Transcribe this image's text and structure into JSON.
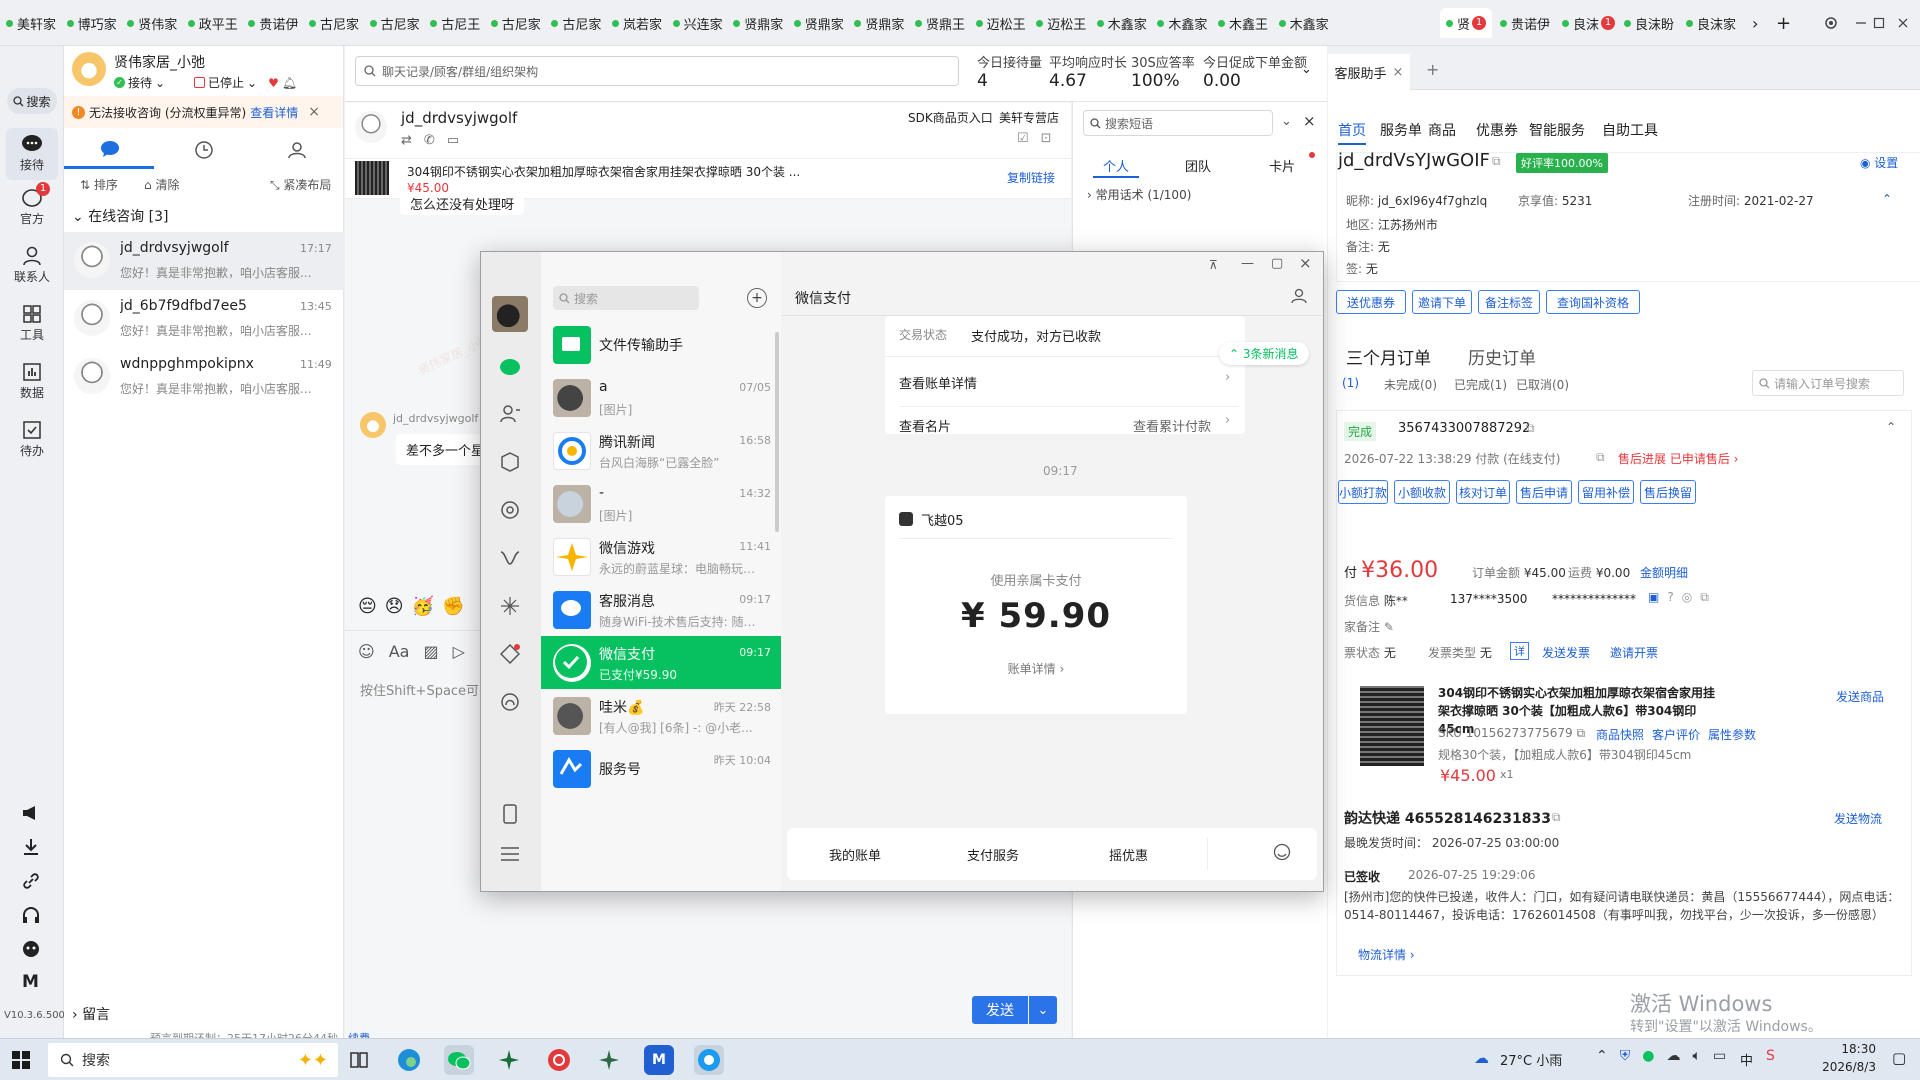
{
  "browser_tabs": [
    "美轩家",
    "博巧家",
    "贤伟家",
    "政平王",
    "贵诺伊",
    "古尼家",
    "古尼家",
    "古尼王",
    "古尼家",
    "古尼家",
    "岚若家",
    "兴连家",
    "贤鼎家",
    "贤鼎家",
    "贤鼎家",
    "贤鼎王",
    "迈松王",
    "迈松王",
    "木鑫家",
    "木鑫家",
    "木鑫王",
    "木鑫家"
  ],
  "tab_active": {
    "label": "贤",
    "badge": "1"
  },
  "tabs_right": [
    {
      "label": "贵诺伊",
      "badge": ""
    },
    {
      "label": "良沫",
      "badge": "1"
    },
    {
      "label": "良沫盼",
      "badge": ""
    },
    {
      "label": "良沫家",
      "badge": ""
    }
  ],
  "tab_more": "›",
  "tab_add": "+",
  "rail": {
    "search": "搜索",
    "items": [
      {
        "label": "接待",
        "icon": "chat-bubble-icon"
      },
      {
        "label": "官方",
        "icon": "notification-icon",
        "badge": "1"
      },
      {
        "label": "联系人",
        "icon": "person-icon"
      },
      {
        "label": "工具",
        "icon": "grid-icon"
      },
      {
        "label": "数据",
        "icon": "chart-icon"
      },
      {
        "label": "待办",
        "icon": "checkbox-icon"
      }
    ],
    "version": "V10.3.6.500"
  },
  "agent": {
    "name": "贤伟家居_小弛",
    "status_receive": "接待",
    "status_stop": "已停止"
  },
  "warning": {
    "text": "无法接收咨询 (分流权重异常)",
    "link": "查看详情"
  },
  "list_tools": {
    "sort": "排序",
    "clear": "清除",
    "layout": "紧凑布局"
  },
  "online": {
    "label": "在线咨询 [3]"
  },
  "conversations": [
    {
      "name": "jd_drdvsyjwgolf",
      "time": "17:17",
      "preview": "您好！真是非常抱歉，咱小店客服..."
    },
    {
      "name": "jd_6b7f9dfbd7ee5",
      "time": "13:45",
      "preview": "您好！真是非常抱歉，咱小店客服..."
    },
    {
      "name": "wdnppghmpokipnx",
      "time": "11:49",
      "preview": "您好！真是非常抱歉，咱小店客服..."
    }
  ],
  "leave_msg": "留言",
  "search_placeholder": "聊天记录/顾客/群组/组织架构",
  "stats": [
    {
      "label": "今日接待量",
      "value": "4"
    },
    {
      "label": "平均响应时长",
      "value": "4.67"
    },
    {
      "label": "30S应答率",
      "value": "100%"
    },
    {
      "label": "今日促成下单金额",
      "value": "0.00"
    }
  ],
  "chat": {
    "customer": "jd_drdvsyjwgolf",
    "shop_tag": "SDK商品页入口",
    "shop_name": "美轩专营店",
    "product_title": "304钢印不锈钢实心衣架加粗加厚晾衣架宿舍家用挂架衣撑晾晒 30个装 ...",
    "product_price": "¥45.00",
    "copy_link": "复制链接",
    "msg_fragment": "怎么还没有处理呀",
    "msg_from": "jd_drdvsyjwgolf",
    "msg_text": "差不多一个星",
    "input_hint": "按住Shift+Space可",
    "send": "发送",
    "bottom_note": "预言到期还制：25天17小时26分44秒",
    "bottom_link": "续费"
  },
  "quick": {
    "search_placeholder": "搜索短语",
    "tabs": [
      "个人",
      "团队",
      "卡片"
    ],
    "group": "常用话术 (1/100)"
  },
  "right": {
    "tab_title": "客服助手",
    "tab_close": "×",
    "tab_add": "+",
    "nav": [
      "首页",
      "服务单",
      "商品",
      "优惠券",
      "智能服务",
      "自助工具"
    ],
    "customer_id": "jd_drdVsYJwGOIF",
    "good_rate": "好评率100.00%",
    "settings": "设置",
    "nick_label": "昵称:",
    "nick": "jd_6xl96y4f7ghzlq",
    "jx_label": "京享值:",
    "jx": "5231",
    "reg_label": "注册时间:",
    "reg": "2021-02-27",
    "area_label": "地区:",
    "area": "江苏扬州市",
    "note_label": "备注:",
    "note": "无",
    "tag_label": "签:",
    "tag": "无",
    "actions": [
      "送优惠券",
      "邀请下单",
      "备注标签",
      "查询国补资格"
    ],
    "order_tabs": [
      "三个月订单",
      "历史订单"
    ],
    "order_filters": [
      "(1)",
      "未完成(0)",
      "已完成(1)",
      "已取消(0)"
    ],
    "order_search": "请输入订单号搜索",
    "order": {
      "status": "完成",
      "no": "3567433007887292",
      "paytime": "2026-07-22 13:38:29 付款",
      "paytype": "(在线支付)",
      "after_sale": "售后进展",
      "after_sale_link": "已申请售后",
      "buttons": [
        "小额打款",
        "小额收款",
        "核对订单",
        "售后申请",
        "留用补偿",
        "售后换留"
      ],
      "paid_label": "付",
      "paid": "¥36.00",
      "amt_label": "订单金额",
      "amt": "¥45.00",
      "ship_label": "运费",
      "ship": "¥0.00",
      "detail_link": "金额明细",
      "recv_label": "货信息",
      "recv": "陈**",
      "phone": "137****3500",
      "addr": "**************",
      "remark_label": "家备注",
      "inv_label": "票状态",
      "inv": "无",
      "inv_type_label": "发票类型",
      "inv_type": "无",
      "inv_detail": "详",
      "inv_send": "发送发票",
      "inv_invite": "邀请开票",
      "product_name": "304钢印不锈钢实心衣架加粗加厚晾衣架宿舍家用挂架衣撑晾晒 30个装【加粗成人款6】带304钢印45cm",
      "send_product": "发送商品",
      "sku_label": "SKU",
      "sku": "10156273775679",
      "sku_links": [
        "商品快照",
        "客户评价",
        "属性参数"
      ],
      "spec": "规格30个装，【加粗成人款6】带304钢印45cm",
      "price": "¥45.00",
      "qty": "x1",
      "express": "韵达快递 465528146231833",
      "send_express": "发送物流",
      "latest_ship_label": "最晚发货时间：",
      "latest_ship": "2026-07-25 03:00:00",
      "signed": "已签收",
      "signed_time": "2026-07-25 19:29:06",
      "track": "[扬州市]您的快件已投递，收件人：门口，如有疑问请电联快递员：黄昌（15556677444），网点电话：0514-80114467，投诉电话：17626014508（有事呼叫我，勿找平台，少一次投诉，多一份感恩）",
      "track_more": "物流详情"
    },
    "activate_title": "激活 Windows",
    "activate_sub": "转到\"设置\"以激活 Windows。"
  },
  "wechat": {
    "search_placeholder": "搜索",
    "chats": [
      {
        "name": "文件传输助手",
        "sub": "",
        "time": "",
        "icon": "folder-icon",
        "color": "#07c160"
      },
      {
        "name": "a",
        "sub": "[图片]",
        "time": "07/05",
        "icon": "avatar",
        "color": "#444"
      },
      {
        "name": "腾讯新闻",
        "sub": "台风白海豚“已露全脸”",
        "time": "16:58",
        "icon": "news-icon",
        "color": "#ffffff"
      },
      {
        "name": "-",
        "sub": "[图片]",
        "time": "14:32",
        "icon": "avatar",
        "color": "#c9d3dd"
      },
      {
        "name": "微信游戏",
        "sub": "永远的蔚蓝星球：电脑畅玩小...",
        "time": "11:41",
        "icon": "game-icon",
        "color": "#ffffff"
      },
      {
        "name": "客服消息",
        "sub": "随身WiFi-技术售后支持: 随身...",
        "time": "09:17",
        "icon": "message-icon",
        "color": "#1a7cf2"
      },
      {
        "name": "微信支付",
        "sub": "已支付¥59.90",
        "time": "09:17",
        "icon": "pay-icon",
        "color": "#07c160"
      },
      {
        "name": "哇米💰",
        "sub": "[有人@我] [6条] -: @小老...",
        "time": "昨天 22:58",
        "icon": "avatar",
        "color": "#555"
      },
      {
        "name": "服务号",
        "sub": "",
        "time": "昨天 10:04",
        "icon": "service-icon",
        "color": "#1a7cf2"
      }
    ],
    "title": "微信支付",
    "pay": {
      "status_label": "交易状态",
      "status": "支付成功，对方已收款",
      "bill_detail": "查看账单详情",
      "card": "查看名片",
      "card_sum": "查看累计付款",
      "new_msg": "3条新消息",
      "time": "09:17",
      "merchant": "飞越05",
      "method": "使用亲属卡支付",
      "amount": "¥ 59.90",
      "detail_link": "账单详情"
    },
    "bottom": [
      "我的账单",
      "支付服务",
      "摇优惠"
    ]
  },
  "taskbar": {
    "search": "搜索",
    "weather": "27°C 小雨",
    "ime": "中",
    "time": "18:30",
    "date": "2026/8/3"
  }
}
